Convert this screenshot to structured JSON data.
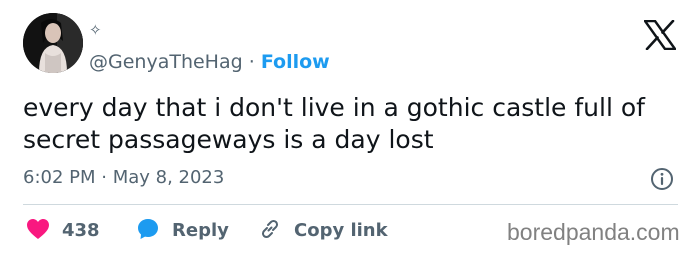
{
  "tweet": {
    "handle": "@GenyaTheHag",
    "separator": "·",
    "follow_label": "Follow",
    "text": "every day that i don't live in a gothic castle full of secret passageways is a day lost",
    "timestamp": "6:02 PM · May 8, 2023"
  },
  "actions": {
    "likes": "438",
    "reply_label": "Reply",
    "copy_label": "Copy link"
  },
  "watermark": "boredpanda.com",
  "icons": {
    "sparkle": "✧",
    "like": "heart-icon",
    "reply": "speech-bubble-icon",
    "copy": "link-icon",
    "info": "info-icon",
    "platform": "x-logo-icon"
  },
  "colors": {
    "accent": "#1d9bf0",
    "like": "#f91880",
    "secondary_text": "#536471",
    "primary_text": "#0f1419"
  }
}
